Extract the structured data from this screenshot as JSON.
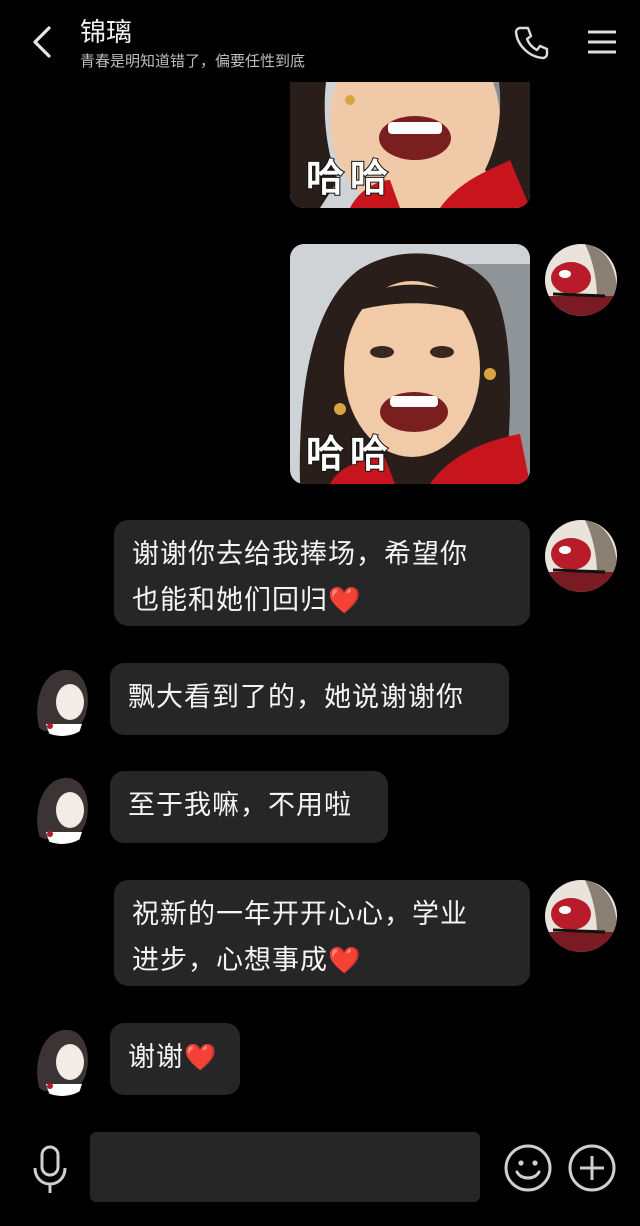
{
  "header": {
    "title": "锦璃",
    "subtitle": "青春是明知道错了，偏要任性到底"
  },
  "messages": [
    {
      "side": "right",
      "type": "image",
      "caption": "哈哈"
    },
    {
      "side": "right",
      "type": "image",
      "caption": "哈哈"
    },
    {
      "side": "right",
      "type": "text",
      "line1": "谢谢你去给我捧场，希望你",
      "line2": "也能和她们回归",
      "emoji": "❤️"
    },
    {
      "side": "left",
      "type": "text",
      "text": "飘大看到了的，她说谢谢你"
    },
    {
      "side": "left",
      "type": "text",
      "text": "至于我嘛，不用啦"
    },
    {
      "side": "right",
      "type": "text",
      "line1": "祝新的一年开开心心，学业",
      "line2": "进步，心想事成",
      "emoji": "❤️"
    },
    {
      "side": "left",
      "type": "text",
      "text": "谢谢",
      "emoji": "❤️"
    }
  ],
  "icons": {
    "back": "chevron-left-icon",
    "call": "phone-icon",
    "menu": "menu-icon",
    "voice": "microphone-icon",
    "emoji": "smiley-icon",
    "more": "plus-circle-icon"
  },
  "input": {
    "value": "",
    "placeholder": ""
  },
  "colors": {
    "background": "#000000",
    "bubble": "#262626",
    "text": "#f4f4f4",
    "heart": "#e8202a"
  }
}
